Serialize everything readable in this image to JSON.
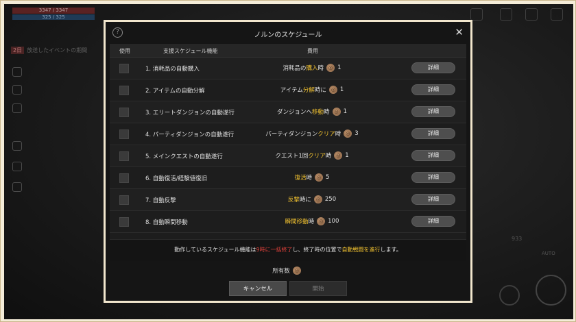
{
  "hud": {
    "hp_text": "3347 / 3347",
    "mp_text": "325 / 325",
    "notice_badge": "2日",
    "notice_text": "放送したイベントの期間",
    "auto_label": "AUTO",
    "count_label": "933"
  },
  "dialog": {
    "title": "ノルンのスケジュール",
    "help_label": "?",
    "close_label": "✕",
    "columns": {
      "use": "使用",
      "feature": "支援スケジュール機能",
      "cost": "費用"
    },
    "rows": [
      {
        "feature": "1. 消耗品の自動購入",
        "pre": "消耗品の",
        "hl": "購入",
        "post": "時",
        "amount": "1",
        "detail": "詳細"
      },
      {
        "feature": "2. アイテムの自動分解",
        "pre": "アイテム",
        "hl": "分解",
        "post": "時に",
        "amount": "1",
        "detail": "詳細"
      },
      {
        "feature": "3. エリートダンジョンの自動遂行",
        "pre": "ダンジョンへ",
        "hl": "移動",
        "post": "時",
        "amount": "1",
        "detail": "詳細"
      },
      {
        "feature": "4. パーティダンジョンの自動遂行",
        "pre": "パーティダンジョン",
        "hl": "クリア",
        "post": "時",
        "amount": "3",
        "detail": "詳細"
      },
      {
        "feature": "5. メインクエストの自動遂行",
        "pre": "クエスト1回",
        "hl": "クリア",
        "post": "時",
        "amount": "1",
        "detail": "詳細"
      },
      {
        "feature": "6. 自動復活/経験値復旧",
        "pre": "",
        "hl": "復活",
        "post": "時",
        "amount": "5",
        "detail": "詳細"
      },
      {
        "feature": "7. 自動反撃",
        "pre": "",
        "hl": "反撃",
        "post": "時に",
        "amount": "250",
        "detail": "詳細"
      },
      {
        "feature": "8. 自動瞬間移動",
        "pre": "",
        "hl": "瞬間移動",
        "post": "時",
        "amount": "100",
        "detail": "詳細"
      }
    ],
    "notice": {
      "part1": "動作しているスケジュール機能は",
      "red": "9時に一括終了",
      "part2": "し、終了時の位置で",
      "yellow": "自動戦闘を進行",
      "part3": "します。"
    },
    "owned_label": "所有数",
    "cancel_label": "キャンセル",
    "start_label": "開始"
  }
}
